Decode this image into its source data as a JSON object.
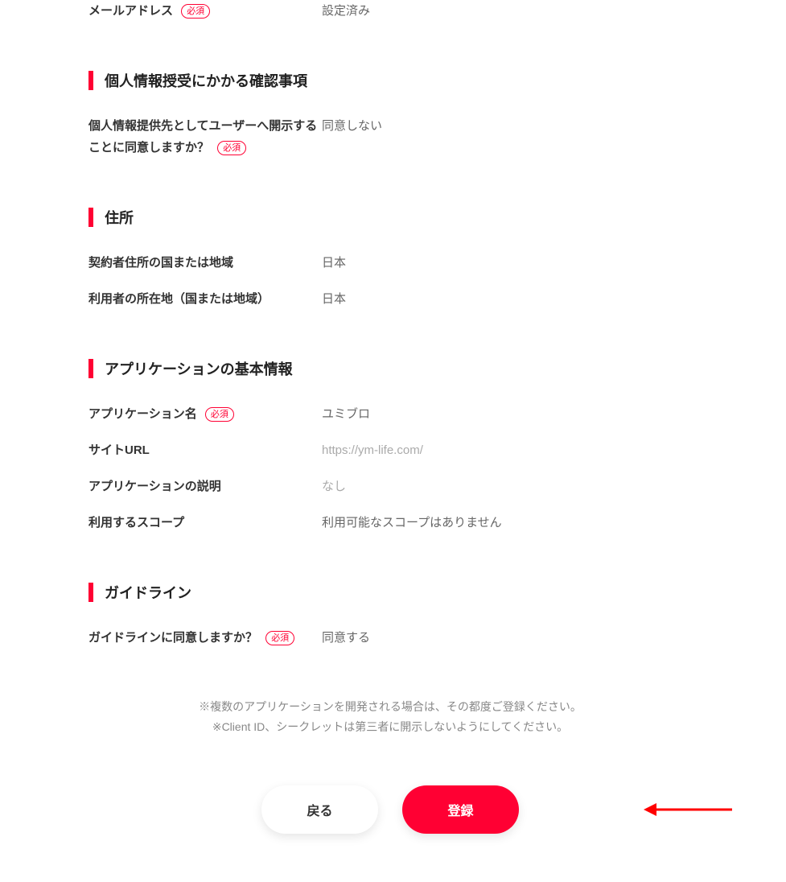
{
  "email": {
    "label": "メールアドレス",
    "value": "設定済み"
  },
  "required_badge": "必須",
  "sections": {
    "personal_info": {
      "title": "個人情報授受にかかる確認事項",
      "disclosure": {
        "label": "個人情報提供先としてユーザーへ開示することに同意しますか？",
        "value": "同意しない"
      }
    },
    "address": {
      "title": "住所",
      "contract_country": {
        "label": "契約者住所の国または地域",
        "value": "日本"
      },
      "user_country": {
        "label": "利用者の所在地（国または地域）",
        "value": "日本"
      }
    },
    "app_basic": {
      "title": "アプリケーションの基本情報",
      "app_name": {
        "label": "アプリケーション名",
        "value": "ユミブロ"
      },
      "site_url": {
        "label": "サイトURL",
        "value": "https://ym-life.com/"
      },
      "app_desc": {
        "label": "アプリケーションの説明",
        "value": "なし"
      },
      "scope": {
        "label": "利用するスコープ",
        "value": "利用可能なスコープはありません"
      }
    },
    "guideline": {
      "title": "ガイドライン",
      "agree": {
        "label": "ガイドラインに同意しますか？",
        "value": "同意する"
      }
    }
  },
  "notes": {
    "line1": "※複数のアプリケーションを開発される場合は、その都度ご登録ください。",
    "line2": "※Client ID、シークレットは第三者に開示しないようにしてください。"
  },
  "buttons": {
    "back": "戻る",
    "register": "登録"
  }
}
